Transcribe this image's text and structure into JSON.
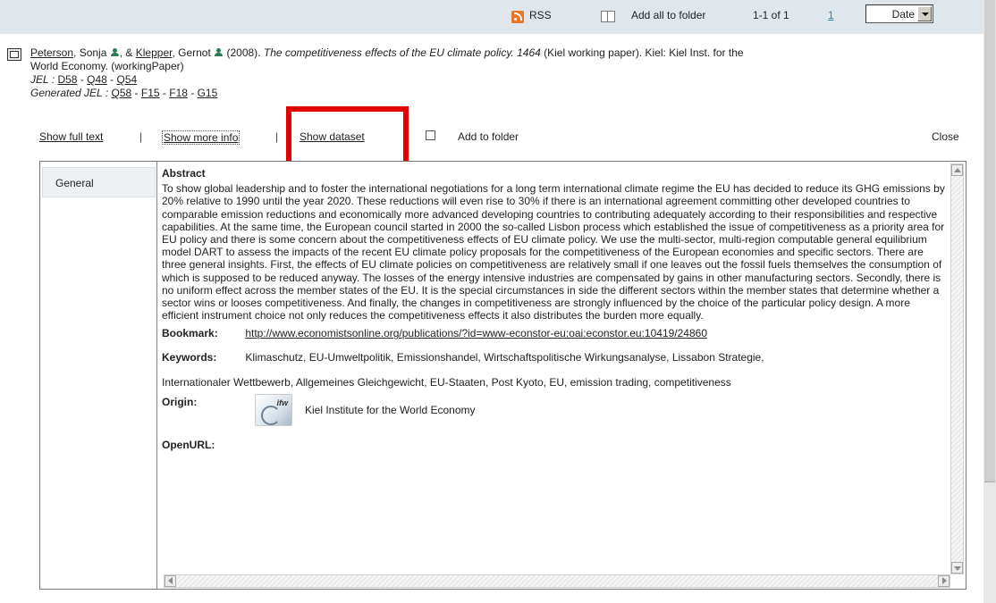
{
  "toolbar": {
    "rss_label": "RSS",
    "add_all_label": "Add all to folder",
    "range_label": "1-1 of 1",
    "page_link": "1",
    "sort_value": "Date"
  },
  "citation": {
    "author1": "Peterson",
    "author1_rest": ", Sonja",
    "sep_and": ", & ",
    "author2": "Klepper",
    "author2_rest": ", Gernot",
    "year": " (2008). ",
    "title": "The competitiveness effects of the EU climate policy. 1464",
    "rest_line1": " (Kiel working paper). Kiel: Kiel Inst. for the",
    "line2": "World Economy. (workingPaper)",
    "jel_label": "JEL : ",
    "jel_codes": [
      "D58",
      "Q48",
      "Q54"
    ],
    "gen_jel_label": "Generated JEL : ",
    "gen_jel_codes": [
      "Q58",
      "F15",
      "F18",
      "G15"
    ],
    "code_sep": " - "
  },
  "actions": {
    "full_text": "Show full text",
    "sep": "|",
    "more_info": "Show more info",
    "dataset": "Show dataset",
    "add_folder": "Add to folder",
    "close": "Close"
  },
  "panel": {
    "tab_general": "General",
    "abstract_title": "Abstract",
    "abstract_text": "To show global leadership and to foster the international negotiations for a long term international climate regime the EU has decided to reduce its GHG emissions by 20% relative to 1990 until the year 2020. These reductions will even rise to 30% if there is an international agreement committing other developed countries to comparable emission reductions and economically more advanced developing countries to contributing adequately according to their responsibilities and respective capabilities. At the same time, the European council started in 2000 the so-called Lisbon process which established the issue of competitiveness as a priority area for EU policy and there is some concern about the competitiveness effects of EU climate policy. We use the multi-sector, multi-region computable general equilibrium model DART to assess the impacts of the recent EU climate policy proposals for the competitiveness of the European economies and specific sectors. There are three general insights. First, the effects of EU climate policies on competitiveness are relatively small if one leaves out the fossil fuels themselves the consumption of which is supposed to be reduced anyway. The losses of the energy intensive industries are compensated by gains in other manufacturing sectors. Secondly, there is no uniform effect across the member states of the EU. It is the special circumstances in side the different sectors within the member states that determine whether a sector wins or looses competitiveness. And finally, the changes in competitiveness are strongly influenced by the choice of the particular policy design. A more efficient instrument choice not only reduces the competitiveness effects it also distributes the burden more equally.",
    "bookmark_label": "Bookmark:",
    "bookmark_url": "http://www.economistsonline.org/publications/?id=www-econstor-eu:oai:econstor.eu:10419/24860",
    "keywords_label": "Keywords:",
    "keywords_line1": "Klimaschutz, EU-Umweltpolitik, Emissionshandel, Wirtschaftspolitische Wirkungsanalyse, Lissabon Strategie,",
    "keywords_line2": "Internationaler Wettbewerb, Allgemeines Gleichgewicht, EU-Staaten, Post Kyoto, EU, emission trading, competitiveness",
    "origin_label": "Origin:",
    "origin_name": "Kiel Institute for the World Economy",
    "openurl_label": "OpenURL:"
  },
  "colors": {
    "toolbar_bg": "#dfe7ec",
    "highlight": "#e00000",
    "author_icon": "#2a7a57",
    "link_page": "#2a8aa8"
  }
}
